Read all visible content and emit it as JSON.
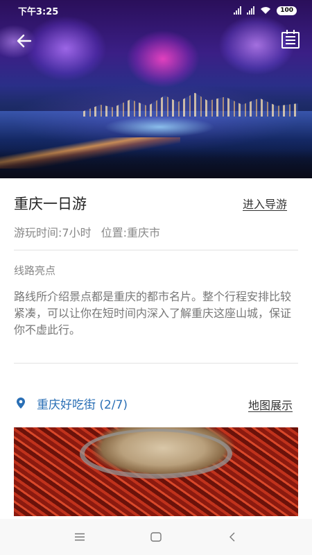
{
  "status_bar": {
    "time": "下午3:25",
    "battery": "100"
  },
  "header": {
    "back_icon": "arrow-left-icon",
    "menu_icon": "document-icon"
  },
  "tour": {
    "title": "重庆一日游",
    "guide_link": "进入导游",
    "duration": "游玩时间:7小时",
    "location": "位置:重庆市",
    "highlights_label": "线路亮点",
    "description": "路线所介绍景点都是重庆的都市名片。整个行程安排比较紧凑，可以让你在短时间内深入了解重庆这座山城，保证你不虚此行。"
  },
  "stop": {
    "title": "重庆好吃街 (2/7)",
    "map_link": "地图展示",
    "pin_icon": "location-pin-icon"
  },
  "nav": {
    "menu_icon": "menu-icon",
    "home_icon": "home-square-icon",
    "back_icon": "back-chevron-icon"
  },
  "colors": {
    "accent": "#2a6fb5",
    "muted_text": "#888888"
  }
}
